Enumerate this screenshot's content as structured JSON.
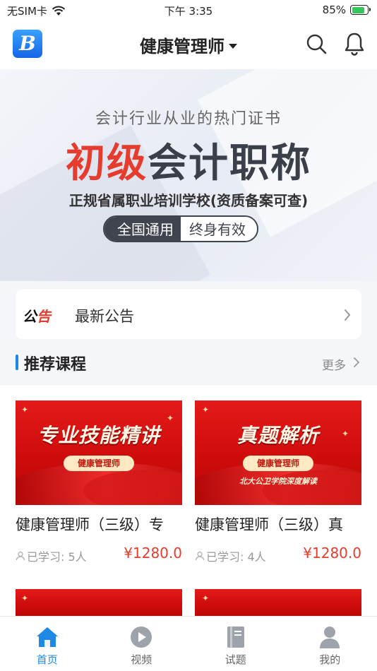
{
  "status_bar": {
    "carrier": "无SIM卡",
    "time": "下午 3:35",
    "battery": "85%"
  },
  "navbar": {
    "title": "健康管理师",
    "logo": "B"
  },
  "banner": {
    "subtitle": "会计行业从业的热门证书",
    "headline_red": "初级",
    "headline_dark": "会计职称",
    "desc": "正规省属职业培训学校(资质备案可查)",
    "pill_left": "全国通用",
    "pill_right": "终身有效"
  },
  "notice": {
    "tag_black": "公",
    "tag_red": "告",
    "label": "最新公告"
  },
  "section": {
    "title": "推荐课程",
    "more": "更多"
  },
  "courses": [
    {
      "thumb_title": "专业技能精讲",
      "thumb_badge": "健康管理师",
      "thumb_sub": "",
      "title": "健康管理师（三级）专",
      "learned": "已学习: 5人",
      "price": "¥1280.0"
    },
    {
      "thumb_title": "真题解析",
      "thumb_badge": "健康管理师",
      "thumb_sub": "北大公卫学院深度解读",
      "title": "健康管理师（三级）真",
      "learned": "已学习: 4人",
      "price": "¥1280.0"
    }
  ],
  "tabbar": [
    {
      "label": "首页",
      "active": true
    },
    {
      "label": "视频",
      "active": false
    },
    {
      "label": "试题",
      "active": false
    },
    {
      "label": "我的",
      "active": false
    }
  ],
  "colors": {
    "accent": "#1e88e5",
    "price": "#e63c2e",
    "banner_red": "#e63c2e"
  }
}
